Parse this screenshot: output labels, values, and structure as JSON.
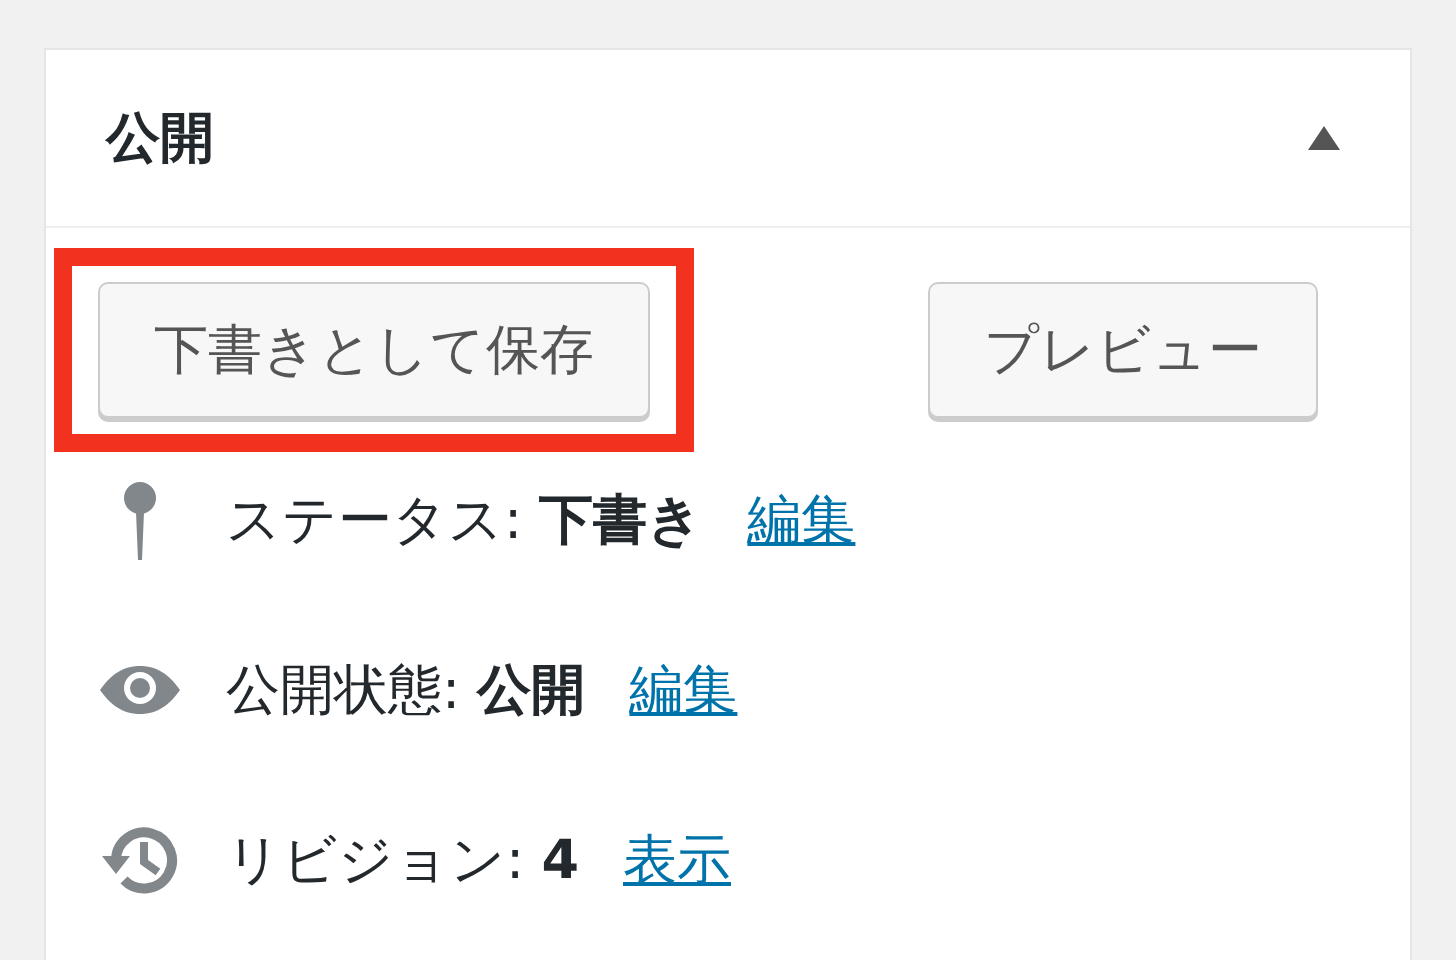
{
  "panel": {
    "title": "公開",
    "expanded": true
  },
  "buttons": [
    {
      "label": "下書きとして保存",
      "highlighted": true
    },
    {
      "label": "プレビュー",
      "highlighted": false
    }
  ],
  "rows": [
    {
      "kind": "status",
      "label": "ステータス:",
      "value": "下書き",
      "link": "編集"
    },
    {
      "kind": "visibility",
      "label": "公開状態:",
      "value": "公開",
      "link": "編集"
    },
    {
      "kind": "revisions",
      "label": "リビジョン:",
      "value": "4",
      "link": "表示"
    }
  ]
}
